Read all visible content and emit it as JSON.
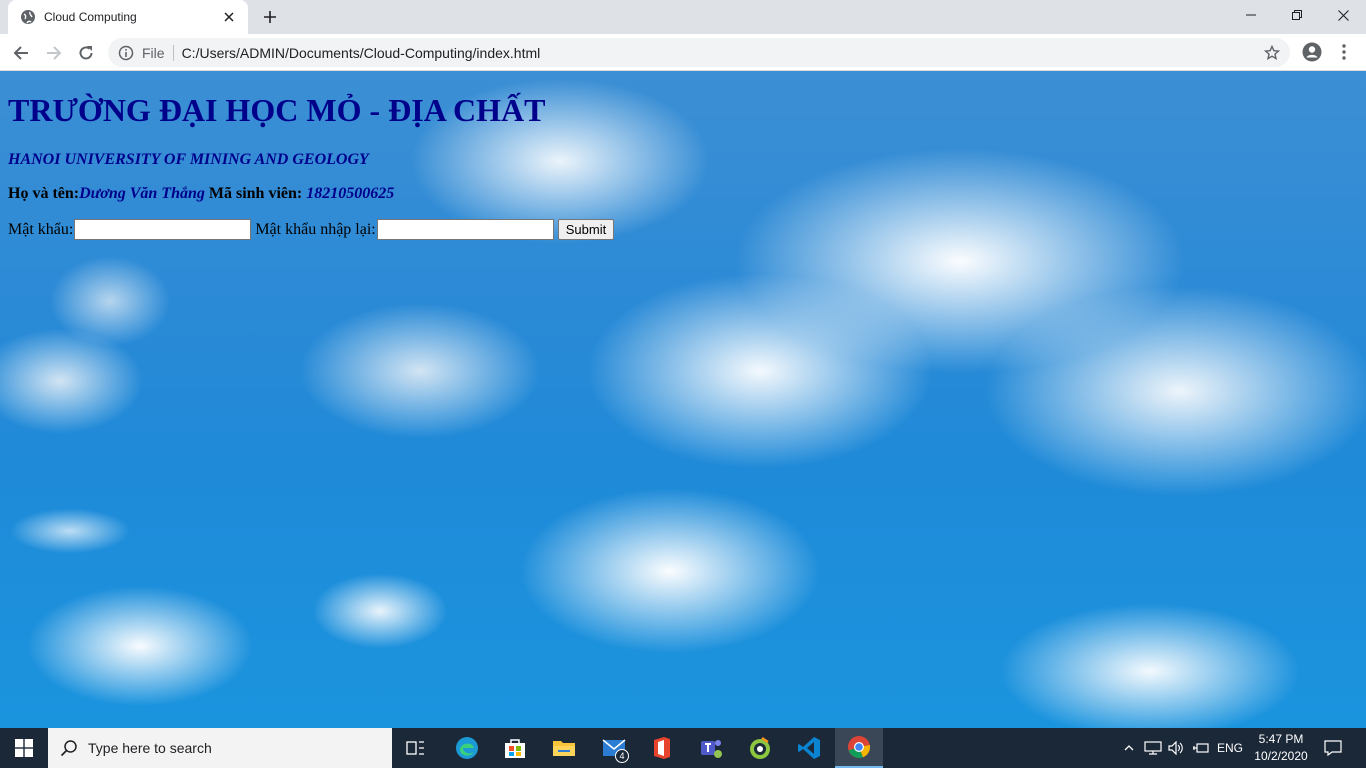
{
  "browser": {
    "tab_title": "Cloud Computing",
    "omnibox_scheme": "File",
    "url": "C:/Users/ADMIN/Documents/Cloud-Computing/index.html"
  },
  "page": {
    "title": "TRƯỜNG ĐẠI HỌC MỎ - ĐỊA CHẤT",
    "subtitle": "HANOI UNIVERSITY OF MINING AND GEOLOGY",
    "name_label": "Họ và tên:",
    "name_value": "Dương Văn Thắng",
    "student_id_label": " Mã sinh viên: ",
    "student_id_value": "18210500625",
    "password_label": "Mật khẩu:",
    "password_value": "",
    "confirm_label": " Mật khẩu nhập lại:",
    "confirm_value": "",
    "submit_label": "Submit"
  },
  "taskbar": {
    "search_placeholder": "Type here to search",
    "mail_badge": "4",
    "language": "ENG",
    "time": "5:47 PM",
    "date": "10/2/2020"
  },
  "colors": {
    "heading": "#00008b",
    "taskbar": "#1b2838",
    "sky": "#2b8ad6"
  }
}
